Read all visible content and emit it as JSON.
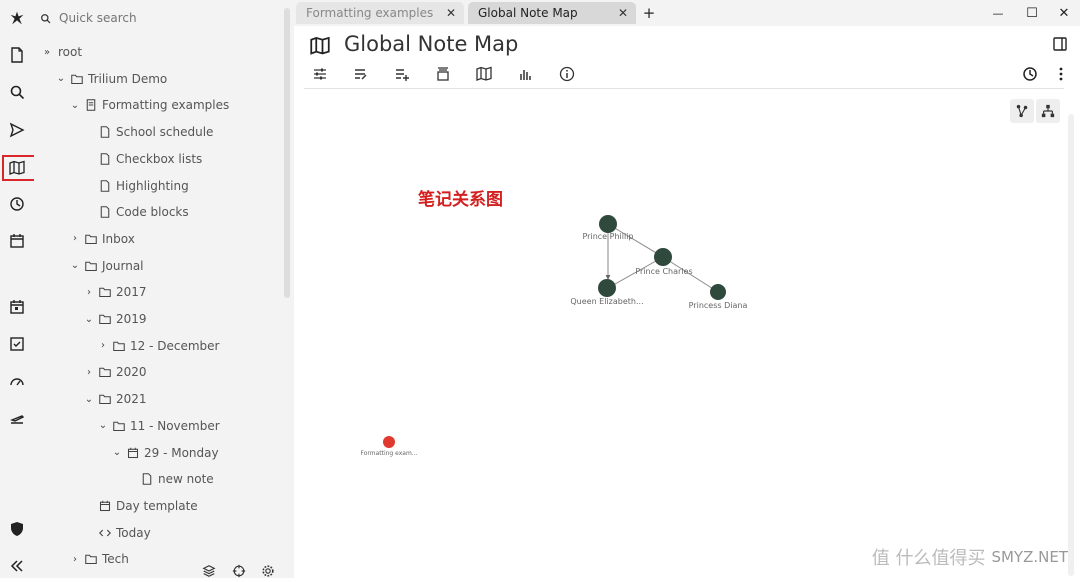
{
  "search": {
    "placeholder": "Quick search"
  },
  "tree": [
    {
      "label": "root",
      "toggle": "»",
      "icon": "none-icon",
      "depth": 0
    },
    {
      "label": "Trilium Demo",
      "toggle": "⌄",
      "icon": "folder-icon",
      "depth": 1
    },
    {
      "label": "Formatting examples",
      "toggle": "⌄",
      "icon": "book-icon",
      "depth": 2
    },
    {
      "label": "School schedule",
      "toggle": "",
      "icon": "note-icon",
      "depth": 3
    },
    {
      "label": "Checkbox lists",
      "toggle": "",
      "icon": "note-icon",
      "depth": 3
    },
    {
      "label": "Highlighting",
      "toggle": "",
      "icon": "note-icon",
      "depth": 3
    },
    {
      "label": "Code blocks",
      "toggle": "",
      "icon": "note-icon",
      "depth": 3
    },
    {
      "label": "Inbox",
      "toggle": "›",
      "icon": "folder-icon",
      "depth": 2
    },
    {
      "label": "Journal",
      "toggle": "⌄",
      "icon": "folder-icon",
      "depth": 2
    },
    {
      "label": "2017",
      "toggle": "›",
      "icon": "folder-icon",
      "depth": 3
    },
    {
      "label": "2019",
      "toggle": "⌄",
      "icon": "folder-icon",
      "depth": 3
    },
    {
      "label": "12 - December",
      "toggle": "›",
      "icon": "folder-icon",
      "depth": 4
    },
    {
      "label": "2020",
      "toggle": "›",
      "icon": "folder-icon",
      "depth": 3
    },
    {
      "label": "2021",
      "toggle": "⌄",
      "icon": "folder-icon",
      "depth": 3
    },
    {
      "label": "11 - November",
      "toggle": "⌄",
      "icon": "folder-icon",
      "depth": 4
    },
    {
      "label": "29 - Monday",
      "toggle": "⌄",
      "icon": "calendar-icon",
      "depth": 5
    },
    {
      "label": "new note",
      "toggle": "",
      "icon": "note-icon",
      "depth": 6
    },
    {
      "label": "Day template",
      "toggle": "",
      "icon": "calendar-icon",
      "depth": 3
    },
    {
      "label": "Today",
      "toggle": "",
      "icon": "code-icon",
      "depth": 3
    },
    {
      "label": "Tech",
      "toggle": "›",
      "icon": "folder-icon",
      "depth": 2
    }
  ],
  "tabs": [
    {
      "label": "Formatting examples",
      "active": false
    },
    {
      "label": "Global Note Map",
      "active": true
    }
  ],
  "tab_new": "+",
  "window": {
    "minimize": "—",
    "maximize": "☐",
    "close": "✕"
  },
  "note": {
    "title": "Global Note Map"
  },
  "map": {
    "nodes": [
      {
        "label": "Prince Phillip",
        "color": "#2f4a3c"
      },
      {
        "label": "Prince Charles",
        "color": "#2f4a3c"
      },
      {
        "label": "Queen Elizabeth...",
        "color": "#2f4a3c"
      },
      {
        "label": "Princess Diana",
        "color": "#2f4a3c"
      },
      {
        "label": "Formatting exam...",
        "color": "#e03a2f"
      }
    ]
  },
  "annotation": "笔记关系图",
  "watermark": "值 什么值得买",
  "watermark_site": "SMYZ.NET",
  "accent": "#d9262b"
}
